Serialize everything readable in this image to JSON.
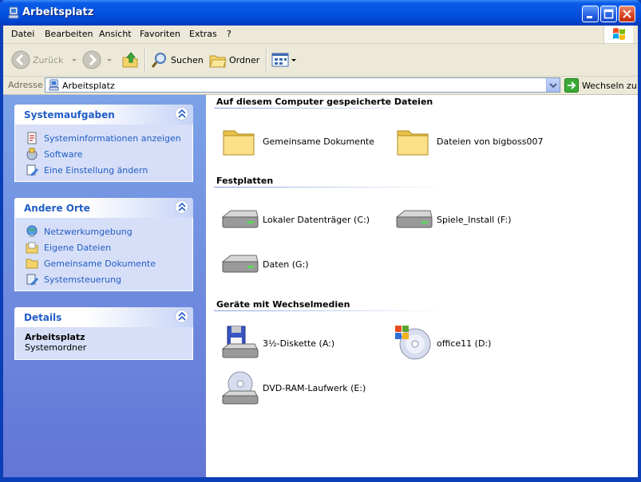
{
  "window": {
    "title": "Arbeitsplatz"
  },
  "menu": [
    "Datei",
    "Bearbeiten",
    "Ansicht",
    "Favoriten",
    "Extras",
    "?"
  ],
  "toolbar": {
    "back_label": "Zurück",
    "search_label": "Suchen",
    "folders_label": "Ordner"
  },
  "address": {
    "label": "Adresse",
    "value": "Arbeitsplatz",
    "go_label": "Wechseln zu"
  },
  "taskpane": {
    "system": {
      "title": "Systemaufgaben",
      "links": [
        {
          "label": "Systeminformationen anzeigen",
          "icon": "system-info-icon"
        },
        {
          "label": "Software",
          "icon": "software-icon"
        },
        {
          "label": "Eine Einstellung ändern",
          "icon": "settings-icon"
        }
      ]
    },
    "places": {
      "title": "Andere Orte",
      "links": [
        {
          "label": "Netzwerkumgebung",
          "icon": "network-icon"
        },
        {
          "label": "Eigene Dateien",
          "icon": "my-documents-icon"
        },
        {
          "label": "Gemeinsame Dokumente",
          "icon": "folder-icon"
        },
        {
          "label": "Systemsteuerung",
          "icon": "control-panel-icon"
        }
      ]
    },
    "details": {
      "title": "Details",
      "name": "Arbeitsplatz",
      "type": "Systemordner"
    }
  },
  "groups": [
    {
      "title": "Auf diesem Computer gespeicherte Dateien",
      "items": [
        {
          "label": "Gemeinsame Dokumente",
          "icon": "folder-icon"
        },
        {
          "label": "Dateien von bigboss007",
          "icon": "folder-icon"
        }
      ]
    },
    {
      "title": "Festplatten",
      "items": [
        {
          "label": "Lokaler Datenträger (C:)",
          "icon": "hard-drive-icon"
        },
        {
          "label": "Spiele_Install (F:)",
          "icon": "hard-drive-icon"
        },
        {
          "label": "Daten (G:)",
          "icon": "hard-drive-icon"
        }
      ]
    },
    {
      "title": "Geräte mit Wechselmedien",
      "items": [
        {
          "label": "3½-Diskette (A:)",
          "icon": "floppy-drive-icon"
        },
        {
          "label": "office11 (D:)",
          "icon": "cd-drive-icon"
        },
        {
          "label": "DVD-RAM-Laufwerk (E:)",
          "icon": "dvd-drive-icon"
        }
      ]
    }
  ],
  "colors": {
    "title_bar": "#0553e0",
    "link": "#215dc6",
    "taskpane_top": "#7ba2e7",
    "taskpane_bottom": "#6375d6"
  }
}
